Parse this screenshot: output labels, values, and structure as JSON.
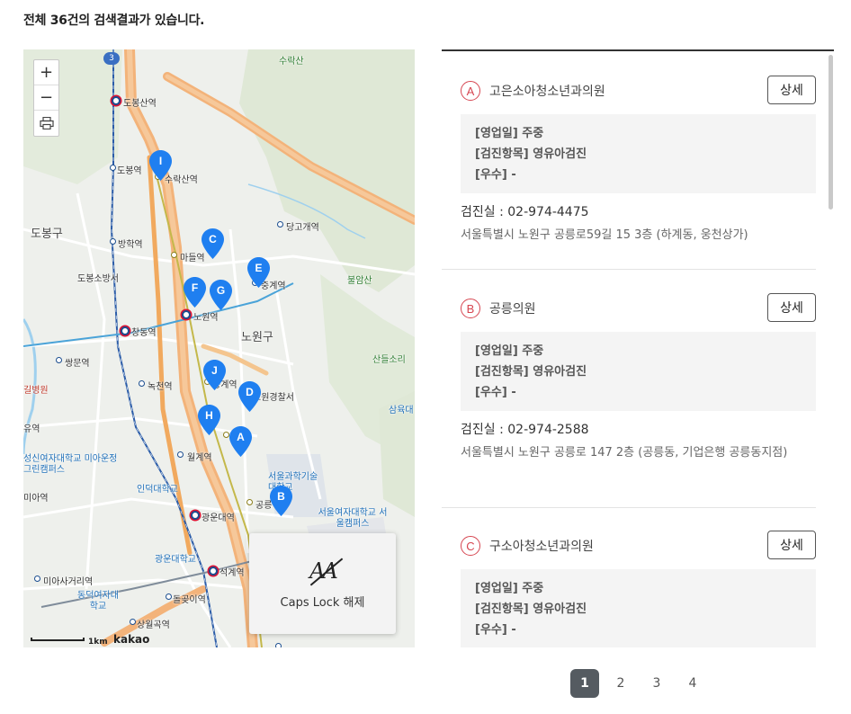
{
  "header": {
    "result_count_text": "전체 36건의 검색결과가 있습니다."
  },
  "map": {
    "zoom_in_label": "+",
    "zoom_out_label": "−",
    "print_icon": "printer-icon",
    "route_badge": "3",
    "labels": {
      "suraksan": "수락산",
      "dobongsan_st": "도봉산역",
      "dobong_st": "도봉역",
      "surak_st": "수락산역",
      "danggogae_st": "당고개역",
      "dobong_gu": "도봉구",
      "banghak_st": "방학역",
      "madeul_st": "마들역",
      "dobong_fire": "도봉소방서",
      "junggye_st": "중계역",
      "bulamsan": "불암산",
      "nowon_st": "노원역",
      "changdong_st": "창동역",
      "nowon_gu": "노원구",
      "ssangmun_st": "쌍문역",
      "sandeul": "산들소리",
      "hospital": "길병원",
      "nokcheon_st": "녹천역",
      "junggye2_st": "중계역",
      "nowon_police": "노원경찰서",
      "samyuk": "삼육대",
      "yu_st": "유역",
      "wolgye_st": "월계역",
      "sungshin": "성신여자대학교 미아운정그린캠퍼스",
      "seoultech": "서울과학기술대학교",
      "ia_st": "미아역",
      "induk": "인덕대학교",
      "gongneung_st": "공릉역",
      "seoul_womens": "서울여자대학교 서울캠퍼스",
      "kwangwoon_st": "광운대역",
      "kwangwoon_univ": "광운대학교",
      "seokgye_st": "석계역",
      "miasageori_st": "미아사거리역",
      "dongduk": "동덕여자대학교",
      "dolgoji_st": "돌곶이역",
      "sangwolgok_st": "상월곡역",
      "scale_km": "1km",
      "brand": "kakao"
    },
    "pins": [
      "I",
      "C",
      "E",
      "F",
      "G",
      "J",
      "D",
      "H",
      "A",
      "B"
    ],
    "pin_color": "#1f7ff0"
  },
  "toast": {
    "icon": "caps-lock-off-icon",
    "text": "Caps Lock 해제"
  },
  "results": [
    {
      "marker": "A",
      "name": "고은소아청소년과의원",
      "detail_label": "상세",
      "hours": "[영업일] 주중",
      "checkup": "[검진항목] 영유아검진",
      "excellent": "[우수] -",
      "phone": "검진실 :  02-974-4475",
      "address": "서울특별시 노원구 공릉로59길 15 3층 (하계동, 웅천상가)"
    },
    {
      "marker": "B",
      "name": "공릉의원",
      "detail_label": "상세",
      "hours": "[영업일] 주중",
      "checkup": "[검진항목] 영유아검진",
      "excellent": "[우수] -",
      "phone": "검진실 :  02-974-2588",
      "address": "서울특별시 노원구 공릉로 147 2층 (공릉동, 기업은행 공릉동지점)"
    },
    {
      "marker": "C",
      "name": "구소아청소년과의원",
      "detail_label": "상세",
      "hours": "[영업일] 주중",
      "checkup": "[검진항목] 영유아검진",
      "excellent": "[우수] -"
    }
  ],
  "pagination": {
    "pages": [
      "1",
      "2",
      "3",
      "4"
    ],
    "current": "1"
  },
  "colors": {
    "marker_red": "#d64550",
    "active_page": "#555b61"
  }
}
